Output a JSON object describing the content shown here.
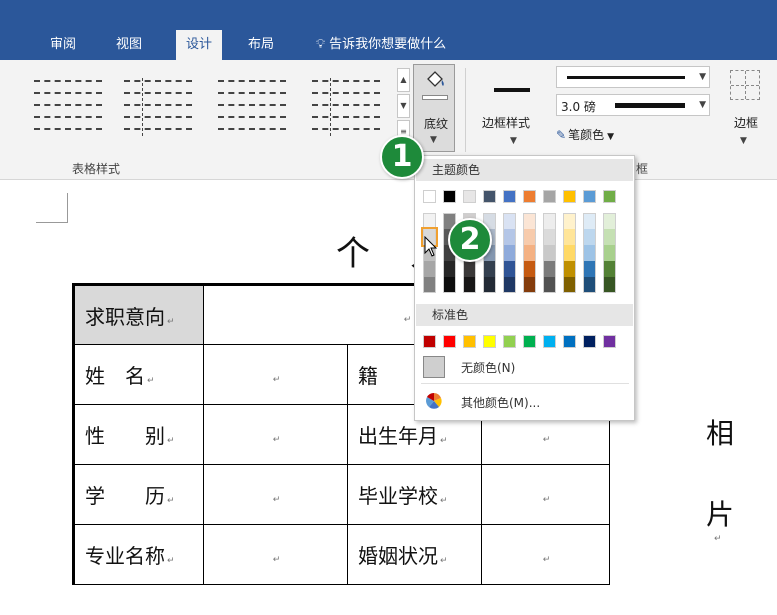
{
  "ribbon": {
    "tabs": [
      {
        "label": "审阅",
        "active": false
      },
      {
        "label": "视图",
        "active": false
      },
      {
        "label": "设计",
        "active": true
      },
      {
        "label": "布局",
        "active": false
      }
    ],
    "tell_me": "告诉我你想要做什么",
    "shading_label": "底纹",
    "border_styles_label": "边框样式",
    "line_weight": "3.0 磅",
    "pen_color_label": "笔颜色",
    "borders_label": "边框",
    "group_table_styles": "表格样式",
    "group_borders": "框"
  },
  "color_dropdown": {
    "theme_colors_title": "主题颜色",
    "standard_colors_title": "标准色",
    "no_color": "无颜色(N)",
    "more_colors": "其他颜色(M)...",
    "theme_colors": [
      "#ffffff",
      "#000000",
      "#e7e6e6",
      "#44546a",
      "#4472c4",
      "#ed7d31",
      "#a5a5a5",
      "#ffc000",
      "#5b9bd5",
      "#70ad47"
    ],
    "theme_shades": [
      [
        "#f2f2f2",
        "#d9d9d9",
        "#bfbfbf",
        "#a6a6a6",
        "#808080"
      ],
      [
        "#808080",
        "#595959",
        "#404040",
        "#262626",
        "#0d0d0d"
      ],
      [
        "#d0cece",
        "#aeabab",
        "#757171",
        "#3a3838",
        "#171616"
      ],
      [
        "#d6dce4",
        "#adb9ca",
        "#8497b0",
        "#333f4f",
        "#222a35"
      ],
      [
        "#d9e2f3",
        "#b4c6e7",
        "#8eaadb",
        "#2f5496",
        "#1f3864"
      ],
      [
        "#fbe5d5",
        "#f7cbac",
        "#f4b183",
        "#c55a11",
        "#843c0c"
      ],
      [
        "#ededed",
        "#dbdbdb",
        "#c9c9c9",
        "#7b7b7b",
        "#525252"
      ],
      [
        "#fff2cc",
        "#ffe599",
        "#ffd966",
        "#bf8f00",
        "#7f6000"
      ],
      [
        "#deebf6",
        "#bdd7ee",
        "#9dc3e6",
        "#2e75b5",
        "#1f4e79"
      ],
      [
        "#e2efd9",
        "#c5e0b3",
        "#a8d08d",
        "#538135",
        "#375623"
      ]
    ],
    "standard_colors": [
      "#c00000",
      "#ff0000",
      "#ffc000",
      "#ffff00",
      "#92d050",
      "#00b050",
      "#00b0f0",
      "#0070c0",
      "#002060",
      "#7030a0"
    ]
  },
  "badges": {
    "step1": "1",
    "step2": "2"
  },
  "document": {
    "title": "个人",
    "paragraph_mark": "↵",
    "rows": [
      {
        "label": "求职意向",
        "value": ""
      },
      {
        "label": "姓　名",
        "value1": "",
        "label2": "籍",
        "value2": ""
      },
      {
        "label": "性　　别",
        "value1": "",
        "label2": "出生年月",
        "value2": ""
      },
      {
        "label": "学　　历",
        "value1": "",
        "label2": "毕业学校",
        "value2": ""
      },
      {
        "label": "专业名称",
        "value1": "",
        "label2": "婚姻状况",
        "value2": ""
      }
    ],
    "photo_label_1": "相",
    "photo_label_2": "片"
  }
}
